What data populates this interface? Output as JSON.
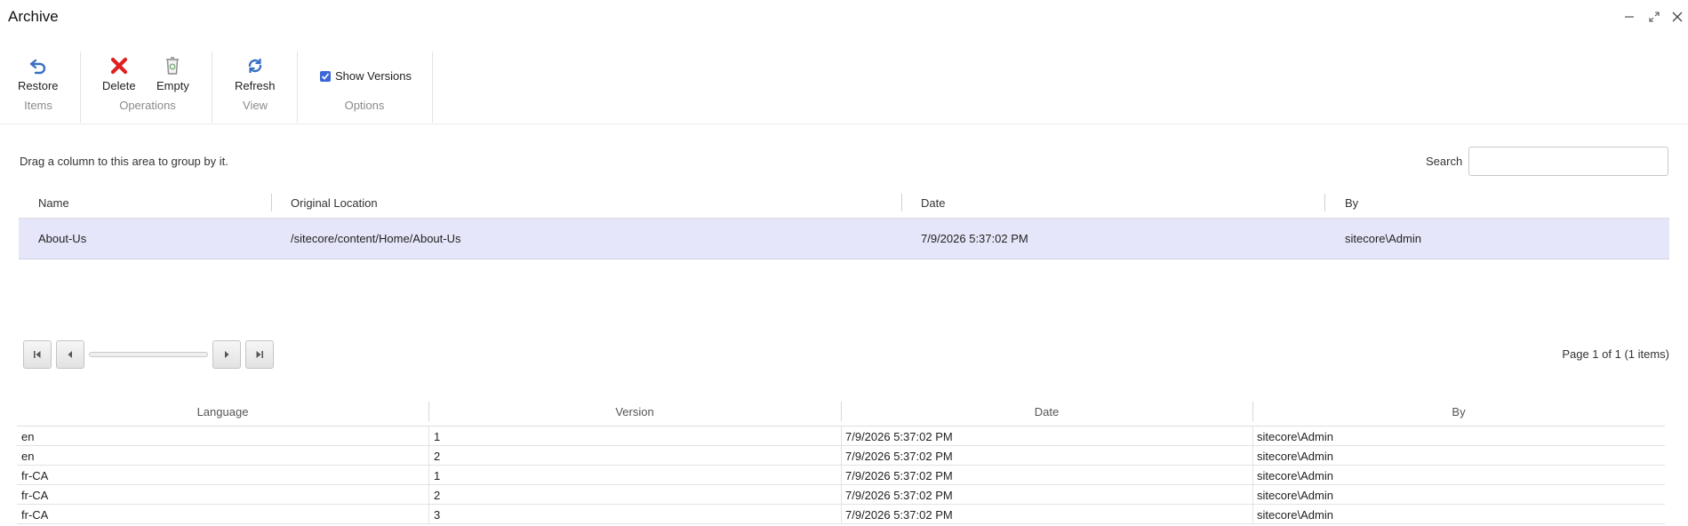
{
  "window": {
    "title": "Archive",
    "controls": {
      "minimize": "minimize-icon",
      "maximize": "expand-icon",
      "close": "close-icon"
    }
  },
  "ribbon": {
    "items_group": {
      "label": "Items",
      "restore_label": "Restore"
    },
    "operations_group": {
      "label": "Operations",
      "delete_label": "Delete",
      "empty_label": "Empty"
    },
    "view_group": {
      "label": "View",
      "refresh_label": "Refresh"
    },
    "options_group": {
      "label": "Options",
      "show_versions_label": "Show Versions",
      "show_versions_checked": true
    }
  },
  "grouping_hint": "Drag a column to this area to group by it.",
  "search": {
    "label": "Search",
    "value": "",
    "placeholder": ""
  },
  "archive_grid": {
    "columns": [
      "Name",
      "Original Location",
      "Date",
      "By"
    ],
    "rows": [
      {
        "name": "About-Us",
        "location": "/sitecore/content/Home/About-Us",
        "date": "7/9/2026 5:37:02 PM",
        "by": "sitecore\\Admin"
      }
    ]
  },
  "pager": {
    "info": "Page 1 of 1 (1 items)"
  },
  "versions_grid": {
    "columns": [
      "Language",
      "Version",
      "Date",
      "By"
    ],
    "rows": [
      {
        "language": "en",
        "version": "1",
        "date": "7/9/2026 5:37:02 PM",
        "by": "sitecore\\Admin"
      },
      {
        "language": "en",
        "version": "2",
        "date": "7/9/2026 5:37:02 PM",
        "by": "sitecore\\Admin"
      },
      {
        "language": "fr-CA",
        "version": "1",
        "date": "7/9/2026 5:37:02 PM",
        "by": "sitecore\\Admin"
      },
      {
        "language": "fr-CA",
        "version": "2",
        "date": "7/9/2026 5:37:02 PM",
        "by": "sitecore\\Admin"
      },
      {
        "language": "fr-CA",
        "version": "3",
        "date": "7/9/2026 5:37:02 PM",
        "by": "sitecore\\Admin"
      }
    ]
  },
  "colors": {
    "selected_row": "#e6e6fa",
    "delete_red": "#e02020",
    "icon_blue": "#3a6fc4",
    "checkbox_blue": "#3a66d6"
  }
}
